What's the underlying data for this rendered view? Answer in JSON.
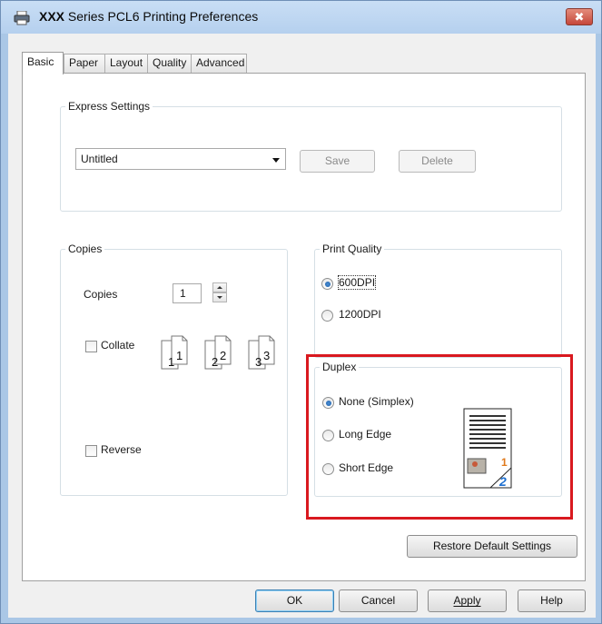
{
  "window": {
    "title_bold": "XXX",
    "title_rest": "Series PCL6 Printing Preferences",
    "close_glyph": "✖"
  },
  "tabs": [
    {
      "label": "Basic",
      "active": true
    },
    {
      "label": "Paper"
    },
    {
      "label": "Layout"
    },
    {
      "label": "Quality"
    },
    {
      "label": "Advanced"
    }
  ],
  "express_settings": {
    "legend": "Express Settings",
    "selected": "Untitled",
    "save_label": "Save",
    "delete_label": "Delete"
  },
  "copies": {
    "legend": "Copies",
    "label": "Copies",
    "value": "1",
    "collate_label": "Collate",
    "collate_checked": false,
    "reverse_label": "Reverse",
    "reverse_checked": false,
    "collate_sheets": [
      "1",
      "2",
      "3"
    ]
  },
  "print_quality": {
    "legend": "Print Quality",
    "options": [
      {
        "label": "600DPI",
        "selected": true
      },
      {
        "label": "1200DPI",
        "selected": false
      }
    ]
  },
  "duplex": {
    "legend": "Duplex",
    "options": [
      {
        "label": "None (Simplex)",
        "selected": true
      },
      {
        "label": "Long Edge",
        "selected": false
      },
      {
        "label": "Short Edge",
        "selected": false
      }
    ],
    "preview_page_number": "2",
    "preview_back_number": "1",
    "highlight_color": "#d9191f"
  },
  "restore_label": "Restore Default Settings",
  "footer": {
    "ok_label": "OK",
    "cancel_label": "Cancel",
    "apply_label": "Apply",
    "help_label": "Help"
  },
  "colors": {
    "accent": "#1d5ea9",
    "highlight": "#d9191f",
    "frame": "#aac7e6"
  }
}
